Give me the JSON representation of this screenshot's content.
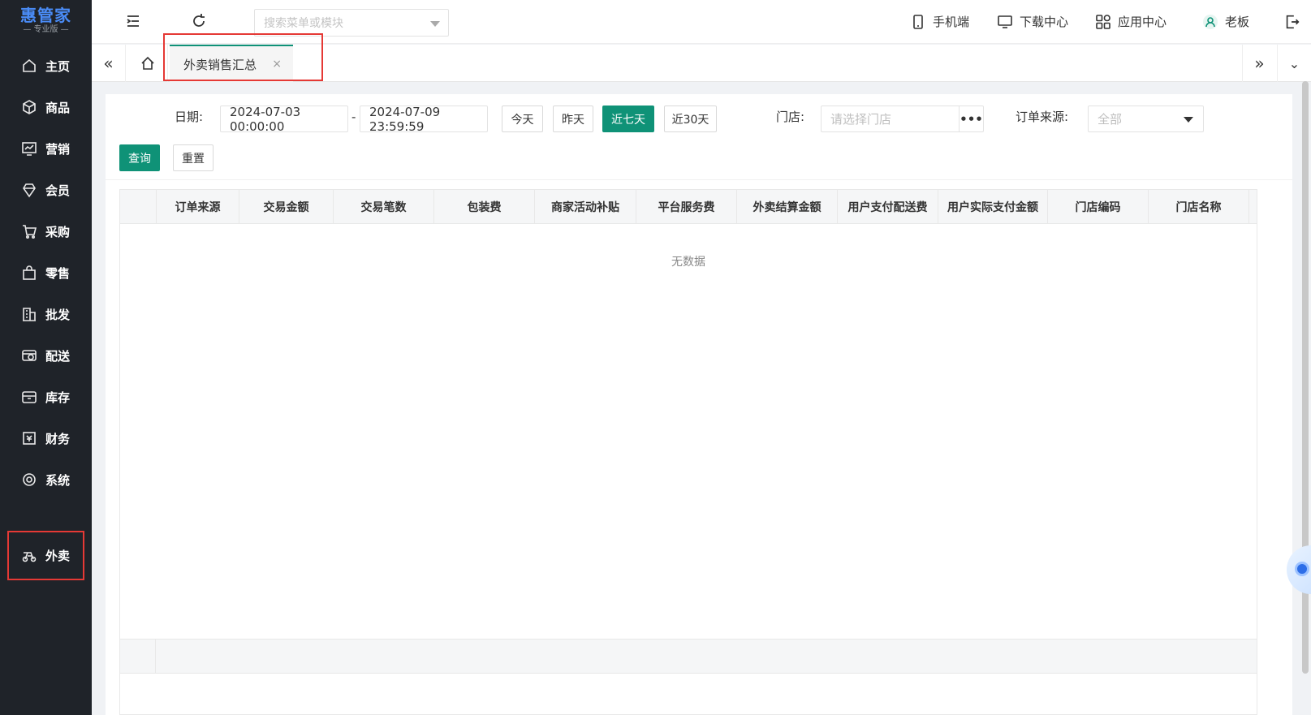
{
  "app": {
    "logo_main": "惠管家",
    "logo_sub": "— 专业版 —"
  },
  "sidebar": {
    "items": [
      {
        "label": "主页",
        "icon": "home-icon"
      },
      {
        "label": "商品",
        "icon": "cube-icon"
      },
      {
        "label": "营销",
        "icon": "chart-icon"
      },
      {
        "label": "会员",
        "icon": "diamond-icon"
      },
      {
        "label": "采购",
        "icon": "cart-icon"
      },
      {
        "label": "零售",
        "icon": "bag-icon"
      },
      {
        "label": "批发",
        "icon": "building-icon"
      },
      {
        "label": "配送",
        "icon": "delivery-icon"
      },
      {
        "label": "库存",
        "icon": "box-icon"
      },
      {
        "label": "财务",
        "icon": "finance-icon"
      },
      {
        "label": "系统",
        "icon": "settings-icon"
      }
    ],
    "special_item": {
      "label": "外卖",
      "icon": "scooter-icon"
    }
  },
  "topbar": {
    "search_placeholder": "搜索菜单或模块",
    "links": {
      "mobile": "手机端",
      "download": "下载中心",
      "apps": "应用中心",
      "user": "老板"
    }
  },
  "tabs": {
    "active_tab": "外卖销售汇总",
    "close_glyph": "×"
  },
  "filters": {
    "date_label": "日期:",
    "start_date": "2024-07-03 00:00:00",
    "date_separator": "-",
    "end_date": "2024-07-09 23:59:59",
    "quick_ranges": [
      "今天",
      "昨天",
      "近七天",
      "近30天"
    ],
    "selected_range": "近七天",
    "store_label": "门店:",
    "store_placeholder": "请选择门店",
    "source_label": "订单来源:",
    "source_value": "全部",
    "query_button": "查询",
    "reset_button": "重置"
  },
  "table": {
    "columns": [
      "订单来源",
      "交易金额",
      "交易笔数",
      "包装费",
      "商家活动补贴",
      "平台服务费",
      "外卖结算金额",
      "用户支付配送费",
      "用户实际支付金额",
      "门店编码",
      "门店名称"
    ],
    "rows": [],
    "empty_text": "无数据"
  },
  "colors": {
    "accent": "#0f9277",
    "sidebar_bg": "#1f2329",
    "highlight_border": "#e53935"
  }
}
